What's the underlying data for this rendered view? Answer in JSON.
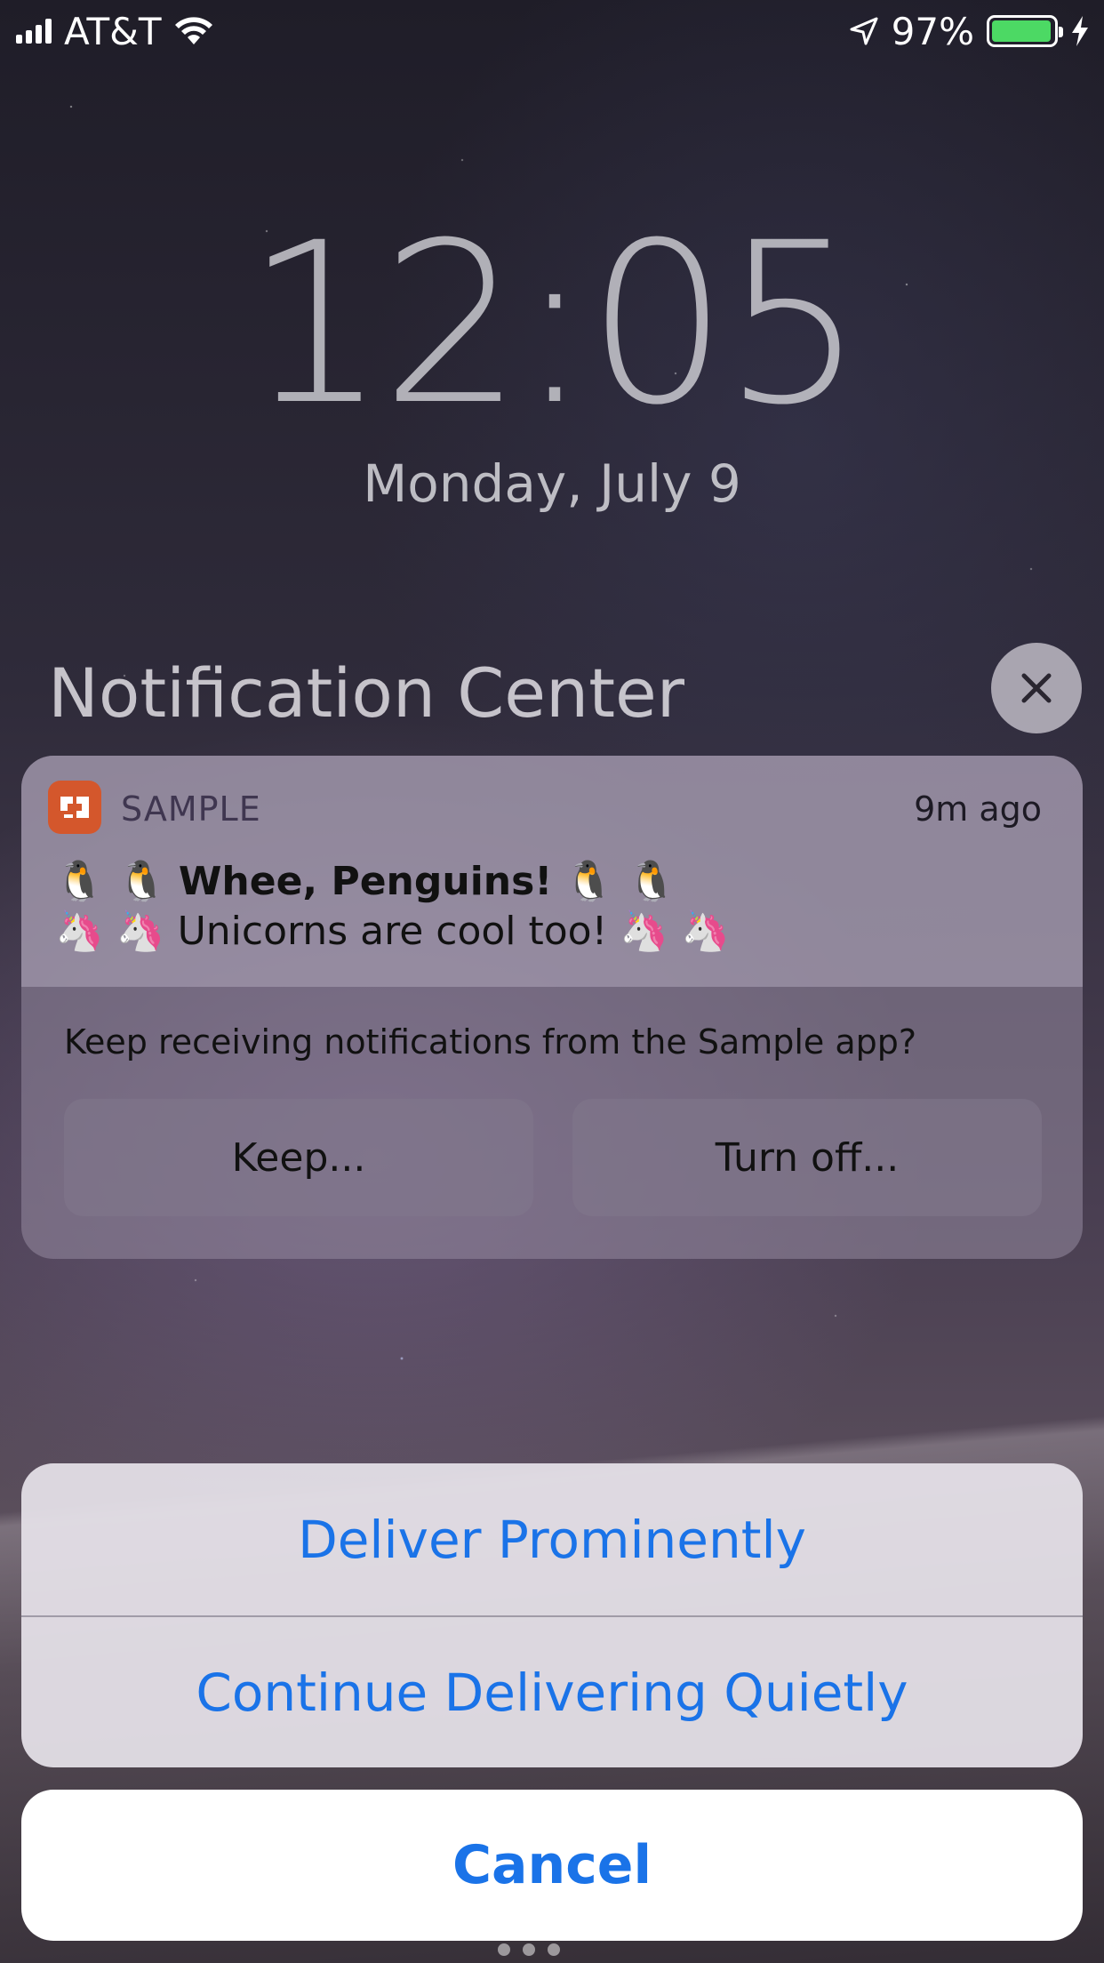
{
  "status_bar": {
    "carrier": "AT&T",
    "battery_percent": "97%",
    "battery_level": 0.97,
    "battery_color": "#4cd964"
  },
  "lock_screen": {
    "time": "12:05",
    "date": "Monday, July 9"
  },
  "notification_center": {
    "title": "Notification Center",
    "close_icon": "close-icon"
  },
  "notification": {
    "app_name": "SAMPLE",
    "app_icon": "sample-app-icon",
    "app_icon_color": "#d4572c",
    "time_ago": "9m ago",
    "title_emoji": "🐧 🐧",
    "title": "Whee, Penguins!",
    "body_emoji": "🦄 🦄",
    "body": "Unicorns are cool too!",
    "prompt": "Keep receiving notifications from the Sample app?",
    "keep_label": "Keep...",
    "turn_off_label": "Turn off..."
  },
  "action_sheet": {
    "deliver_prominently": "Deliver Prominently",
    "deliver_quietly": "Continue Delivering Quietly",
    "cancel": "Cancel",
    "accent_color": "#1a73e8"
  }
}
